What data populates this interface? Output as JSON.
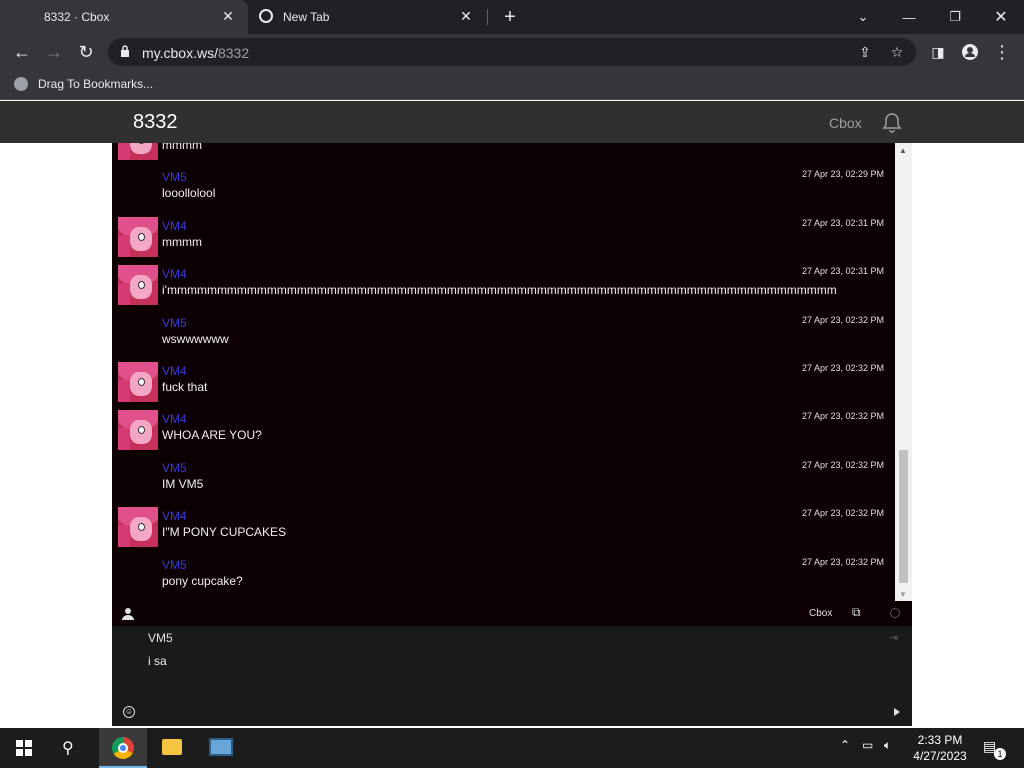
{
  "browser": {
    "tabs": [
      {
        "title": "8332 · Cbox",
        "active": true
      },
      {
        "title": "New Tab",
        "active": false
      }
    ],
    "url_domain": "my.cbox.ws/",
    "url_path": "8332",
    "bookmarks_label": "Drag To Bookmarks..."
  },
  "site": {
    "title": "8332",
    "brand": "Cbox"
  },
  "chat": {
    "messages": [
      {
        "name": "",
        "time": "",
        "text": "mmmm",
        "avatar": true
      },
      {
        "name": "VM5",
        "time": "27 Apr 23, 02:29 PM",
        "text": "looollolool",
        "avatar": false
      },
      {
        "name": "VM4",
        "time": "27 Apr 23, 02:31 PM",
        "text": "mmmm",
        "avatar": true
      },
      {
        "name": "VM4",
        "time": "27 Apr 23, 02:31 PM",
        "text": "i'mmmmmmmmmmmmmmmmmmmmmmmmmmmmmmmmmmmmmmmmmmmmmmmmmmmmmmmmmmmmmmmmmmm",
        "avatar": true
      },
      {
        "name": "VM5",
        "time": "27 Apr 23, 02:32 PM",
        "text": "wswwwwww",
        "avatar": false
      },
      {
        "name": "VM4",
        "time": "27 Apr 23, 02:32 PM",
        "text": "fuck that",
        "avatar": true
      },
      {
        "name": "VM4",
        "time": "27 Apr 23, 02:32 PM",
        "text": "WHOA ARE YOU?",
        "avatar": true
      },
      {
        "name": "VM5",
        "time": "27 Apr 23, 02:32 PM",
        "text": "IM VM5",
        "avatar": false
      },
      {
        "name": "VM4",
        "time": "27 Apr 23, 02:32 PM",
        "text": "I\"M PONY CUPCAKES",
        "avatar": true
      },
      {
        "name": "VM5",
        "time": "27 Apr 23, 02:32 PM",
        "text": "pony cupcake?",
        "avatar": false
      }
    ],
    "footer_brand": "Cbox",
    "post_name": "VM5",
    "post_text": "i sa"
  },
  "taskbar": {
    "time": "2:33 PM",
    "date": "4/27/2023",
    "notification_count": "1"
  },
  "icons": {
    "tab_favicon": "cbox-favicon",
    "newtab_favicon": "chrome-favicon",
    "bell": "bell-icon",
    "user": "user-icon"
  }
}
